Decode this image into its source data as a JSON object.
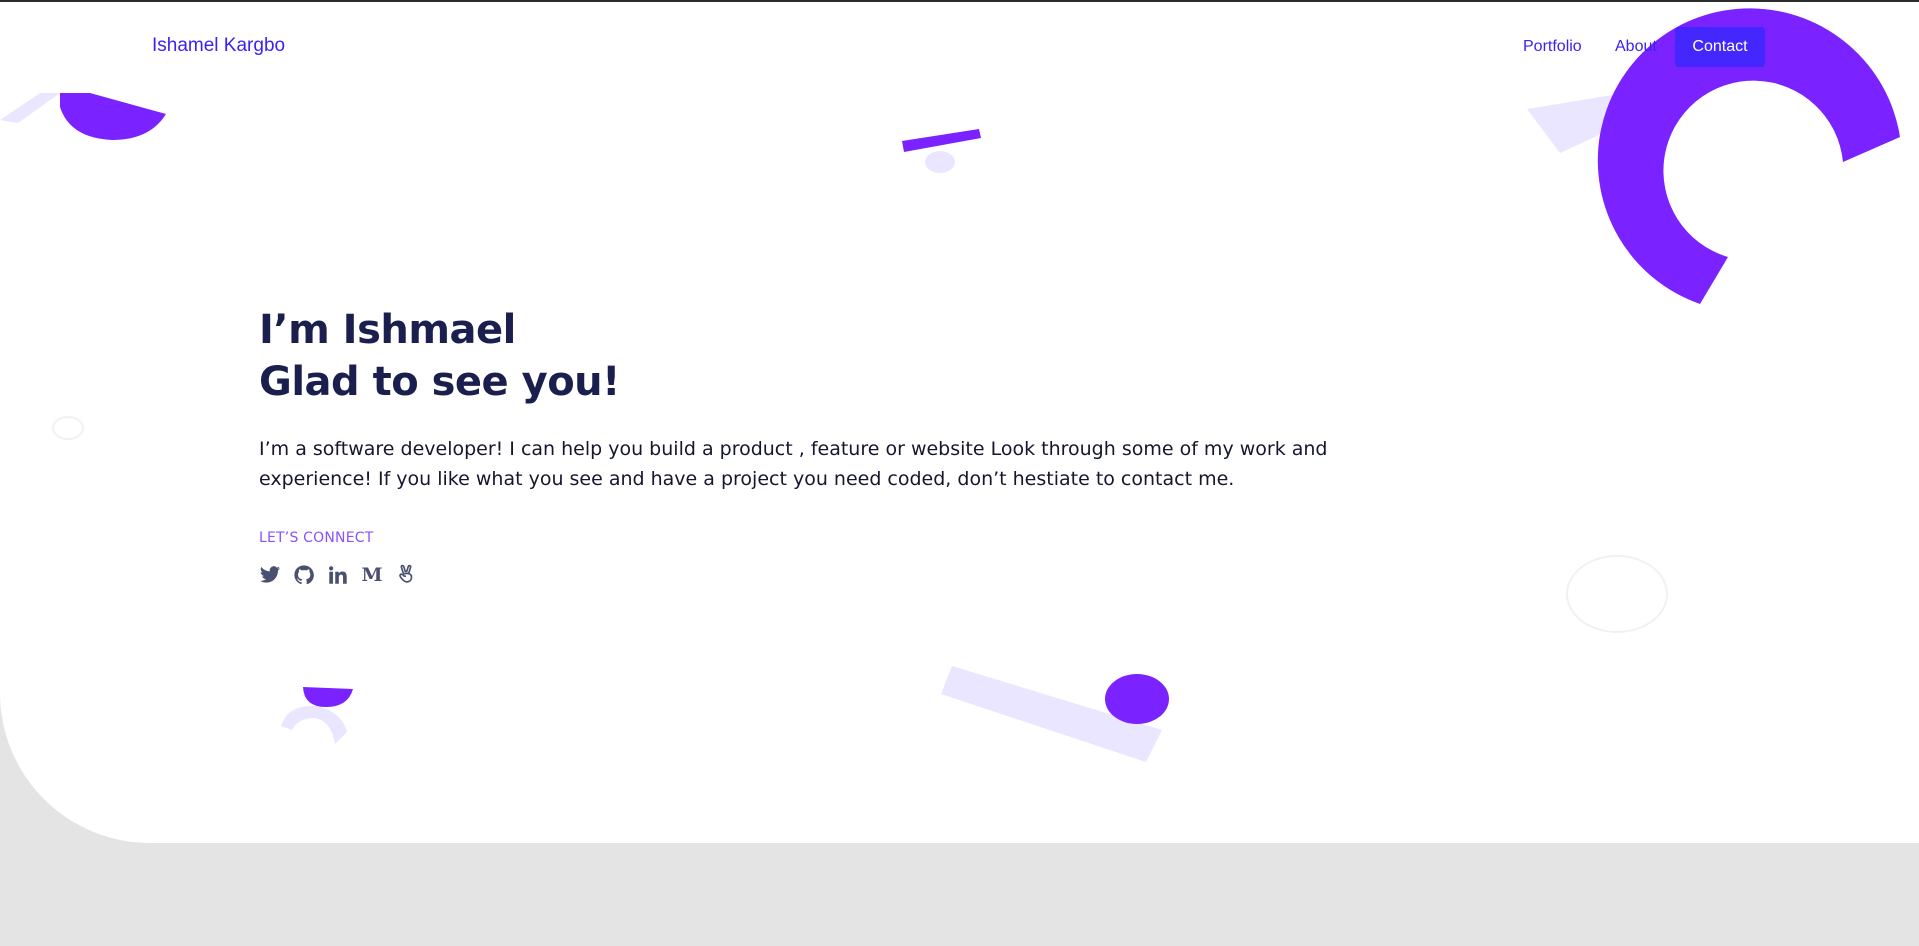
{
  "brand": {
    "name": "Ishamel Kargbo"
  },
  "nav": {
    "items": [
      {
        "label": "Portfolio"
      },
      {
        "label": "About"
      }
    ],
    "cta_label": "Contact"
  },
  "hero": {
    "headline_line1": "I’m Ishmael",
    "headline_line2": "Glad to see you!",
    "intro": "I’m a software developer! I can help you build a product , feature or website Look through some of my work and experience! If you like what you see and have a project you need coded, don’t hestiate to contact me.",
    "connect_label": "LET’S CONNECT",
    "socials": [
      {
        "icon": "twitter-icon"
      },
      {
        "icon": "github-icon"
      },
      {
        "icon": "linkedin-icon"
      },
      {
        "icon": "medium-icon",
        "glyph": "M"
      },
      {
        "icon": "angellist-icon"
      }
    ]
  },
  "colors": {
    "accent": "#4426ff",
    "shape_purple": "#7a22ff",
    "shape_light": "#ebe6ff",
    "heading": "#1a1f4e",
    "background_footer": "#e4e4e4"
  }
}
